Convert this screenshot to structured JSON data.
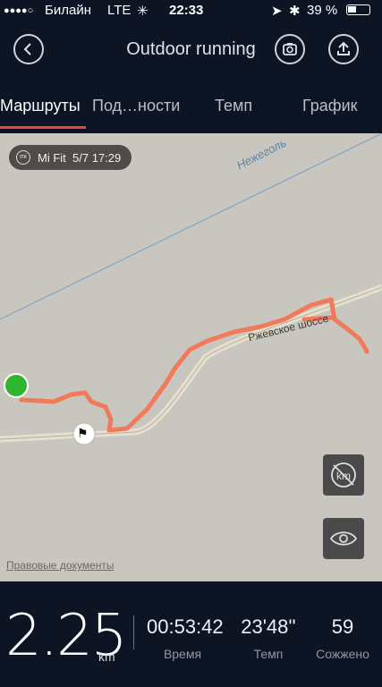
{
  "status": {
    "signal": "●●●●○",
    "carrier": "Билайн",
    "network": "LTE",
    "time": "22:33",
    "battery": "39 %"
  },
  "header": {
    "title": "Outdoor running"
  },
  "tabs": [
    {
      "label": "Маршруты"
    },
    {
      "label": "Под…ности"
    },
    {
      "label": "Темп"
    },
    {
      "label": "График"
    }
  ],
  "map": {
    "source_app": "Mi Fit",
    "source_time": "5/7 17:29",
    "road_label_1": "Нежеголь",
    "road_label_2": "Ржевское шоссе",
    "legal_link": "Правовые документы",
    "route_color": "#f07a5a",
    "start_color": "#2fb52f"
  },
  "stats": {
    "distance": "2.25",
    "distance_unit": "km",
    "duration": "00:53:42",
    "duration_label": "Время",
    "pace": "23'48''",
    "pace_label": "Темп",
    "calories": "59",
    "calories_label": "Сожжено"
  }
}
